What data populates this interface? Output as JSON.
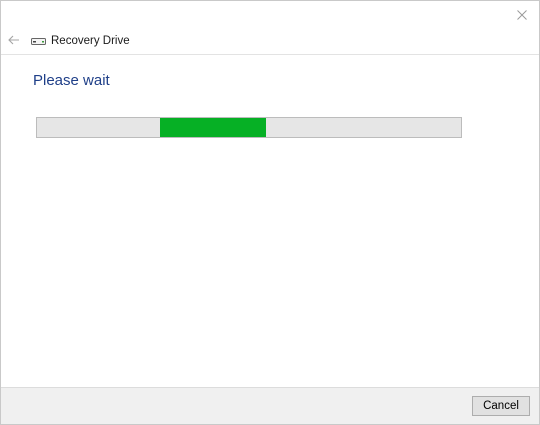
{
  "window": {
    "title": "Recovery Drive",
    "heading": "Please wait"
  },
  "progress": {
    "indeterminate": true,
    "chunk_start_fraction": 0.29,
    "chunk_fraction": 0.25,
    "fill_color": "#06b025"
  },
  "footer": {
    "cancel_label": "Cancel"
  },
  "icons": {
    "close": "close-icon",
    "back": "back-arrow-icon",
    "app": "drive-icon"
  },
  "colors": {
    "heading": "#1f3f88",
    "progress_track": "#e6e6e6",
    "footer_bg": "#f0f0f0"
  }
}
